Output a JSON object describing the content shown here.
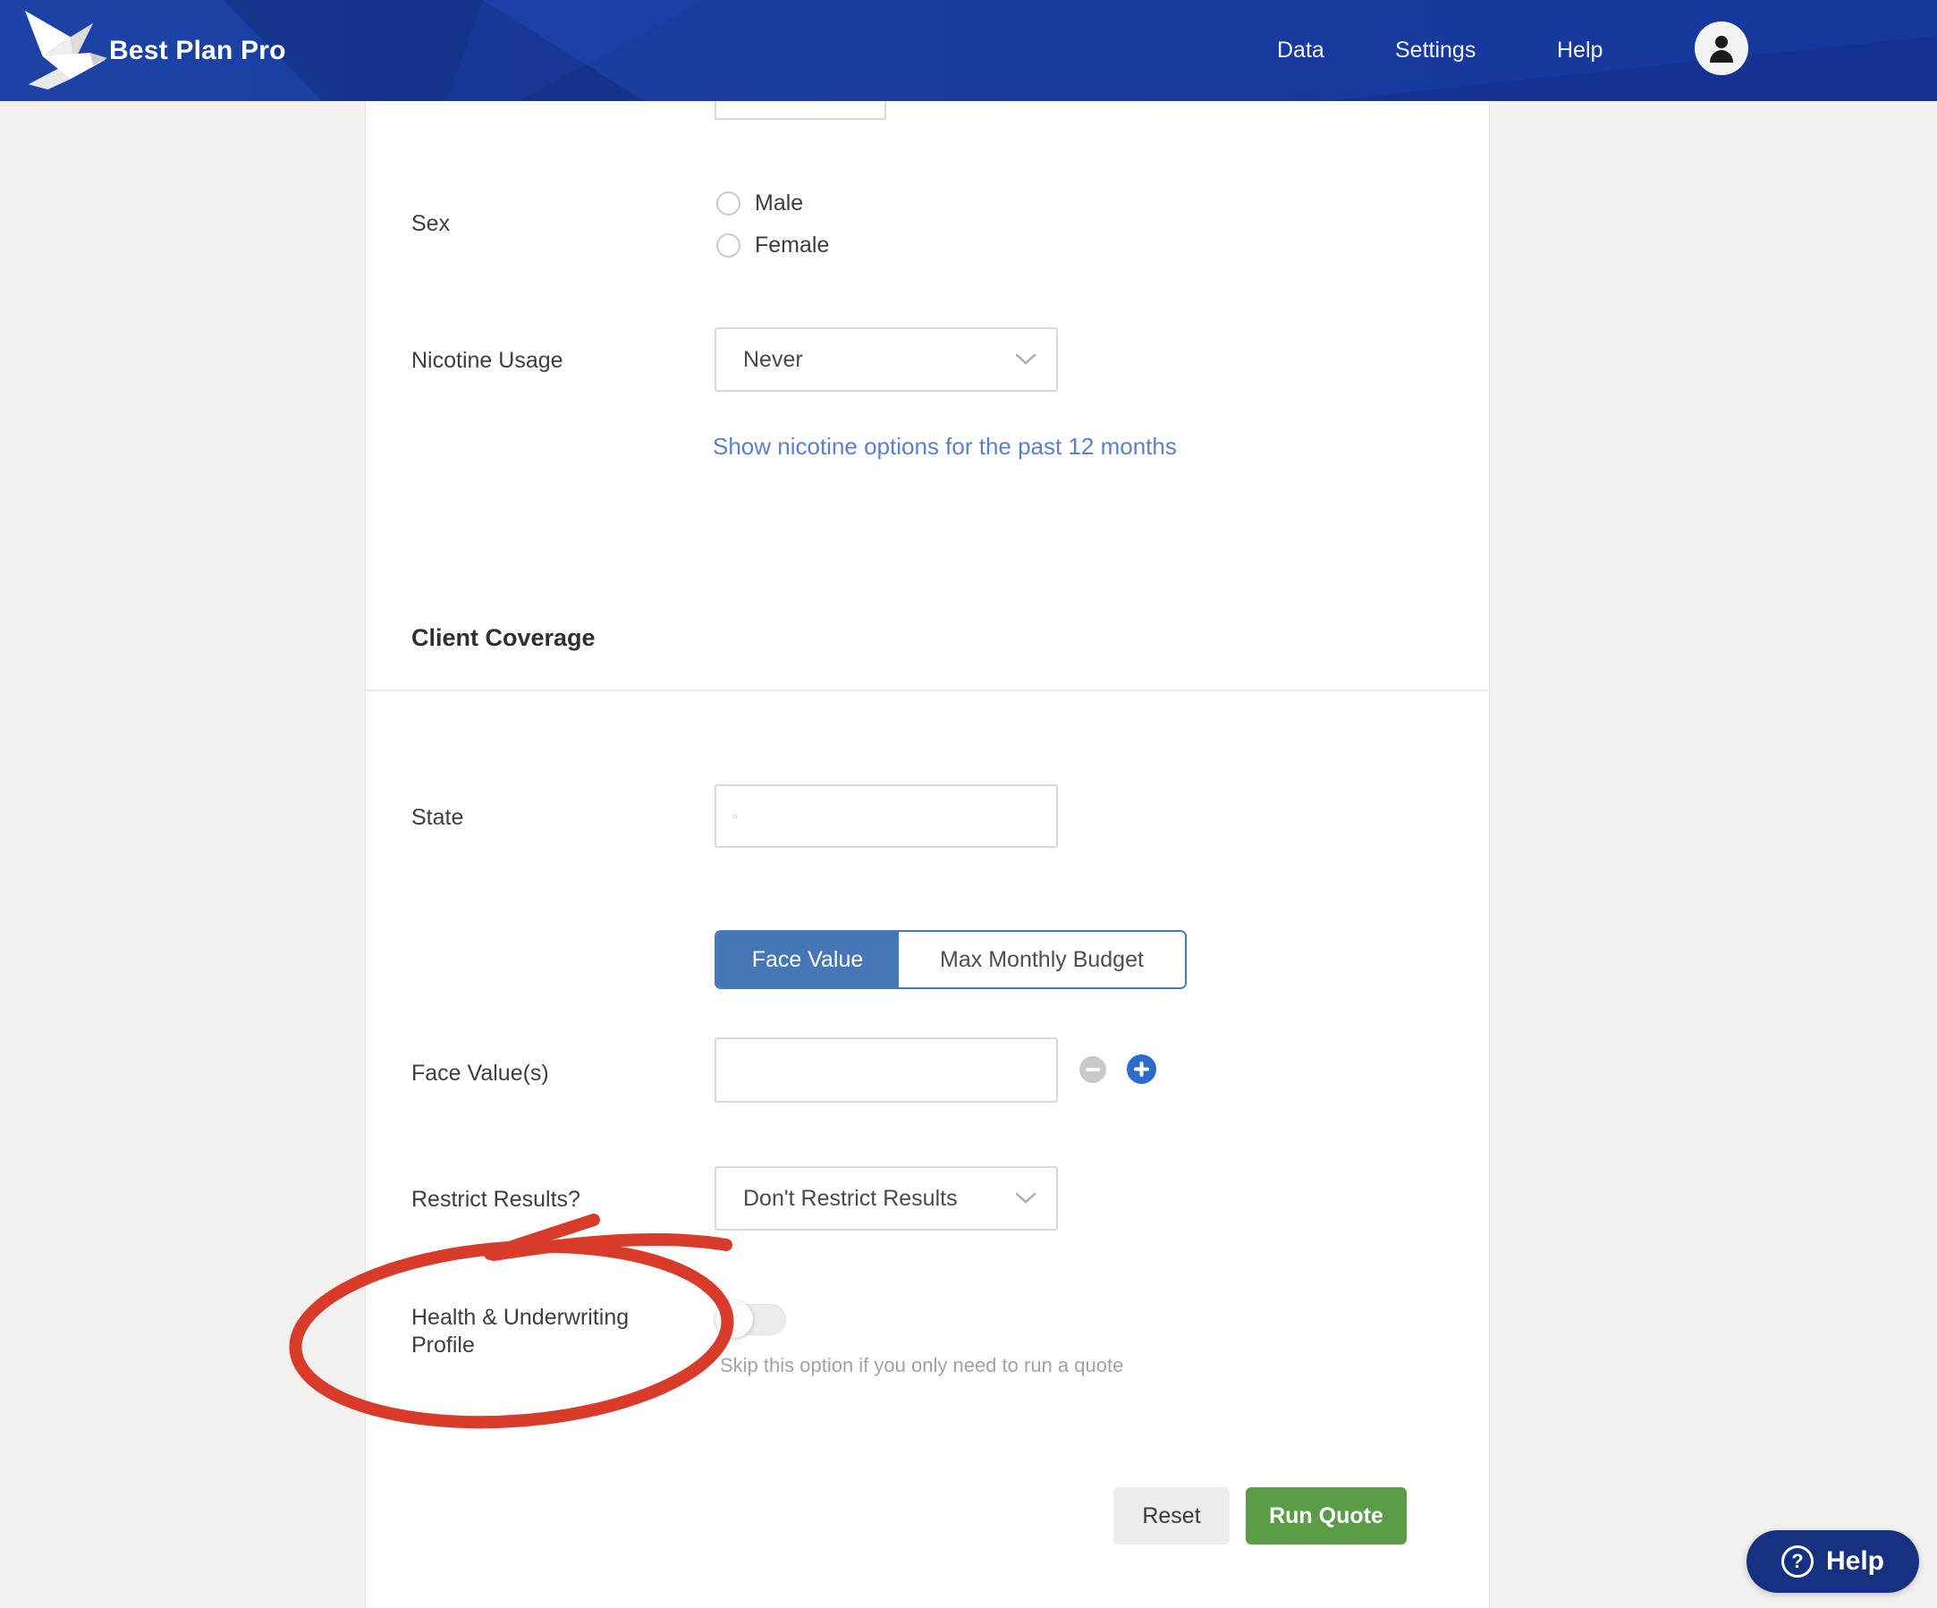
{
  "navbar": {
    "brand": "Best Plan Pro",
    "items": [
      "Data",
      "Settings",
      "Help"
    ]
  },
  "form": {
    "sex": {
      "label": "Sex",
      "options": [
        "Male",
        "Female"
      ],
      "selected": ""
    },
    "nicotine": {
      "label": "Nicotine Usage",
      "value": "Never",
      "link": "Show nicotine options for the past 12 months"
    },
    "section": {
      "heading": "Client Coverage"
    },
    "state": {
      "label": "State",
      "value": ""
    },
    "coverage_tabs": {
      "face_value": "Face Value",
      "max_monthly_budget": "Max Monthly Budget",
      "active": "Face Value"
    },
    "face_values": {
      "label": "Face Value(s)",
      "value": ""
    },
    "restrict": {
      "label": "Restrict Results?",
      "value": "Don't Restrict Results"
    },
    "health_profile": {
      "label": "Health & Underwriting Profile",
      "toggle_state": "off",
      "hint": "Skip this option if you only need to run a quote"
    },
    "actions": {
      "reset": "Reset",
      "run_quote": "Run Quote"
    }
  },
  "help_widget": {
    "label": "Help"
  },
  "colors": {
    "navbar_blue": "#1a3da1",
    "accent_blue": "#4577b6",
    "plus_blue": "#2a6bcc",
    "link_blue": "#5b80c7",
    "run_quote_green": "#5b9c47",
    "help_pill_navy": "#16317f",
    "annotation_red": "#d93b2a"
  }
}
